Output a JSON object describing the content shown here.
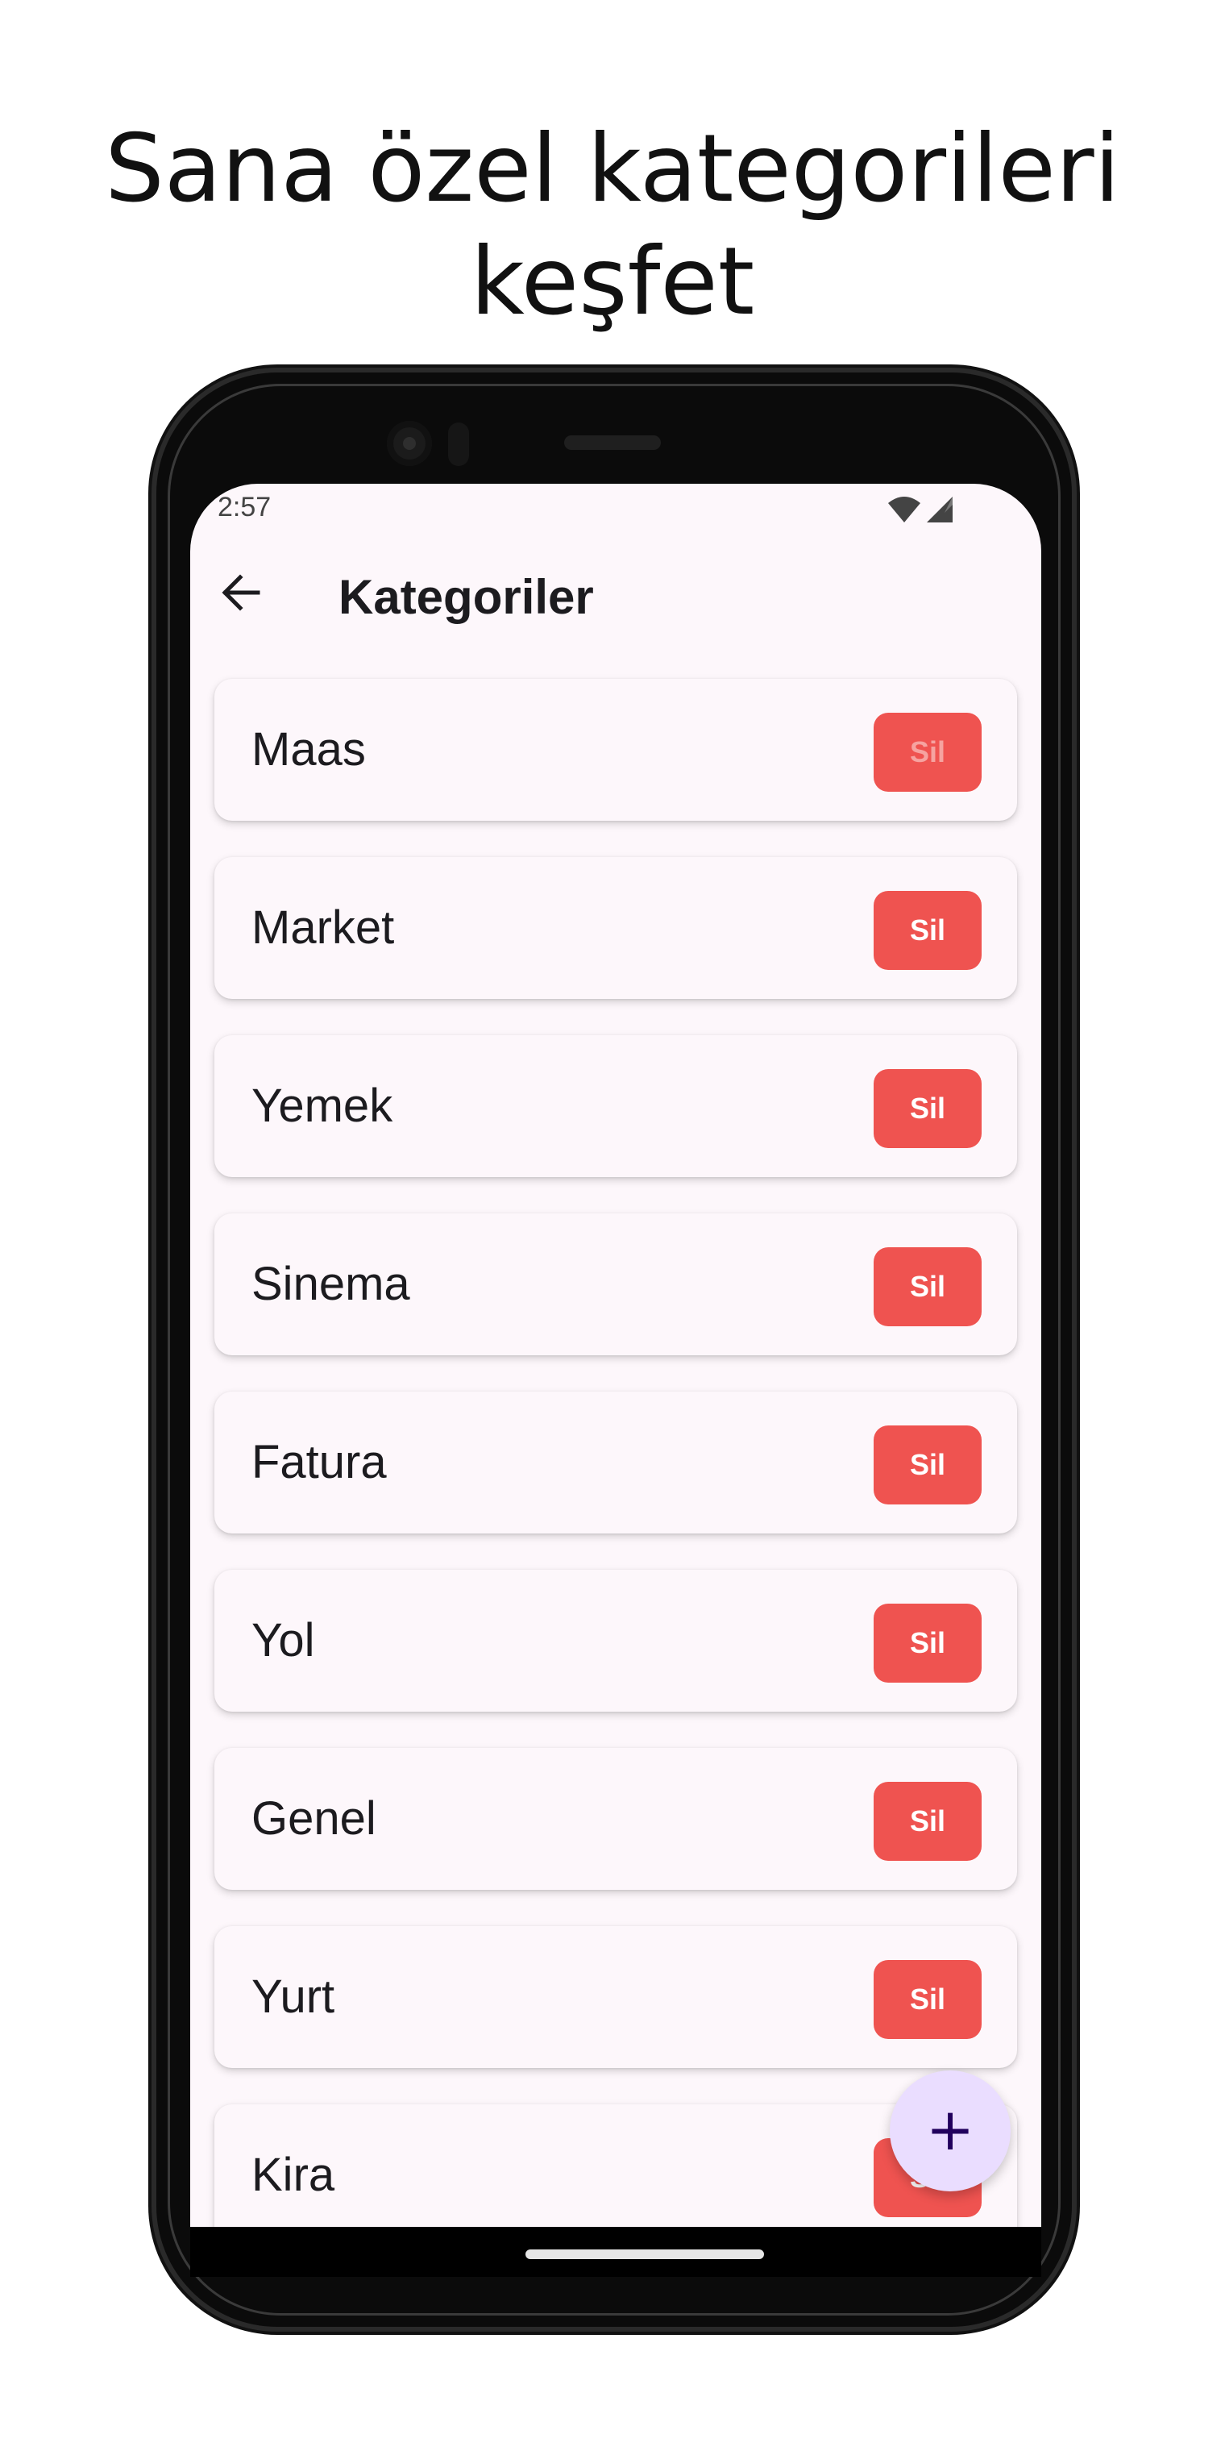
{
  "headline": {
    "line1": "Sana özel kategorileri",
    "line2": "keşfet"
  },
  "status_bar": {
    "time": "2:57",
    "icons": [
      "wifi-icon",
      "signal-icon"
    ]
  },
  "app_bar": {
    "back_icon": "arrow-left-icon",
    "title": "Kategoriler"
  },
  "categories": [
    {
      "label": "Maas",
      "delete_label": "Sil"
    },
    {
      "label": "Market",
      "delete_label": "Sil"
    },
    {
      "label": "Yemek",
      "delete_label": "Sil"
    },
    {
      "label": "Sinema",
      "delete_label": "Sil"
    },
    {
      "label": "Fatura",
      "delete_label": "Sil"
    },
    {
      "label": "Yol",
      "delete_label": "Sil"
    },
    {
      "label": "Genel",
      "delete_label": "Sil"
    },
    {
      "label": "Yurt",
      "delete_label": "Sil"
    },
    {
      "label": "Kira",
      "delete_label": "Sil"
    }
  ],
  "fab": {
    "icon": "plus-icon",
    "glyph": "+"
  },
  "colors": {
    "screen_background": "#fdf7fb",
    "delete_button": "#ef5350",
    "fab_background": "#eaddff",
    "fab_icon": "#21005d"
  }
}
